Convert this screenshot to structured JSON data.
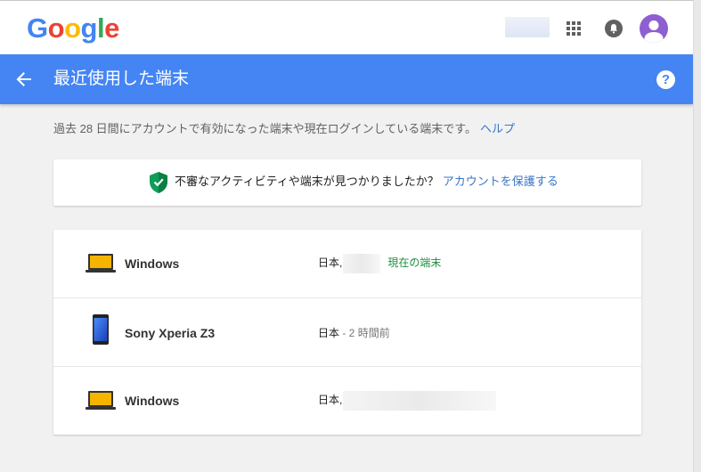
{
  "header": {
    "logo_letters": [
      {
        "char": "G",
        "color": "#4285f4"
      },
      {
        "char": "o",
        "color": "#ea4335"
      },
      {
        "char": "o",
        "color": "#fbbc05"
      },
      {
        "char": "g",
        "color": "#4285f4"
      },
      {
        "char": "l",
        "color": "#34a853"
      },
      {
        "char": "e",
        "color": "#ea4335"
      }
    ],
    "icons": [
      "apps-grid-icon",
      "notifications-bell-icon",
      "account-avatar-icon"
    ]
  },
  "titlebar": {
    "title": "最近使用した端末",
    "back_icon": "arrow-back-icon",
    "help_icon": "help-icon",
    "help_glyph": "?",
    "color": "#4485f3"
  },
  "description": {
    "text": "過去 28 日間にアカウントで有効になった端末や現在ログインしている端末です。",
    "help_link": "ヘルプ"
  },
  "alert": {
    "icon": "shield-check-icon",
    "text": "不審なアクティビティや端末が見つかりましたか？",
    "link": "アカウントを保護する"
  },
  "devices": [
    {
      "name": "Windows",
      "icon": "laptop-icon",
      "location": "日本,",
      "status": "現在の端末"
    },
    {
      "name": "Sony Xperia Z3",
      "icon": "phone-icon",
      "location": "日本",
      "time": " - 2 時間前"
    },
    {
      "name": "Windows",
      "icon": "laptop-icon",
      "location": "日本,"
    }
  ],
  "colors": {
    "link": "#3a75c4",
    "current_device": "#1e8e3e",
    "laptop_screen": "#f4b400"
  }
}
